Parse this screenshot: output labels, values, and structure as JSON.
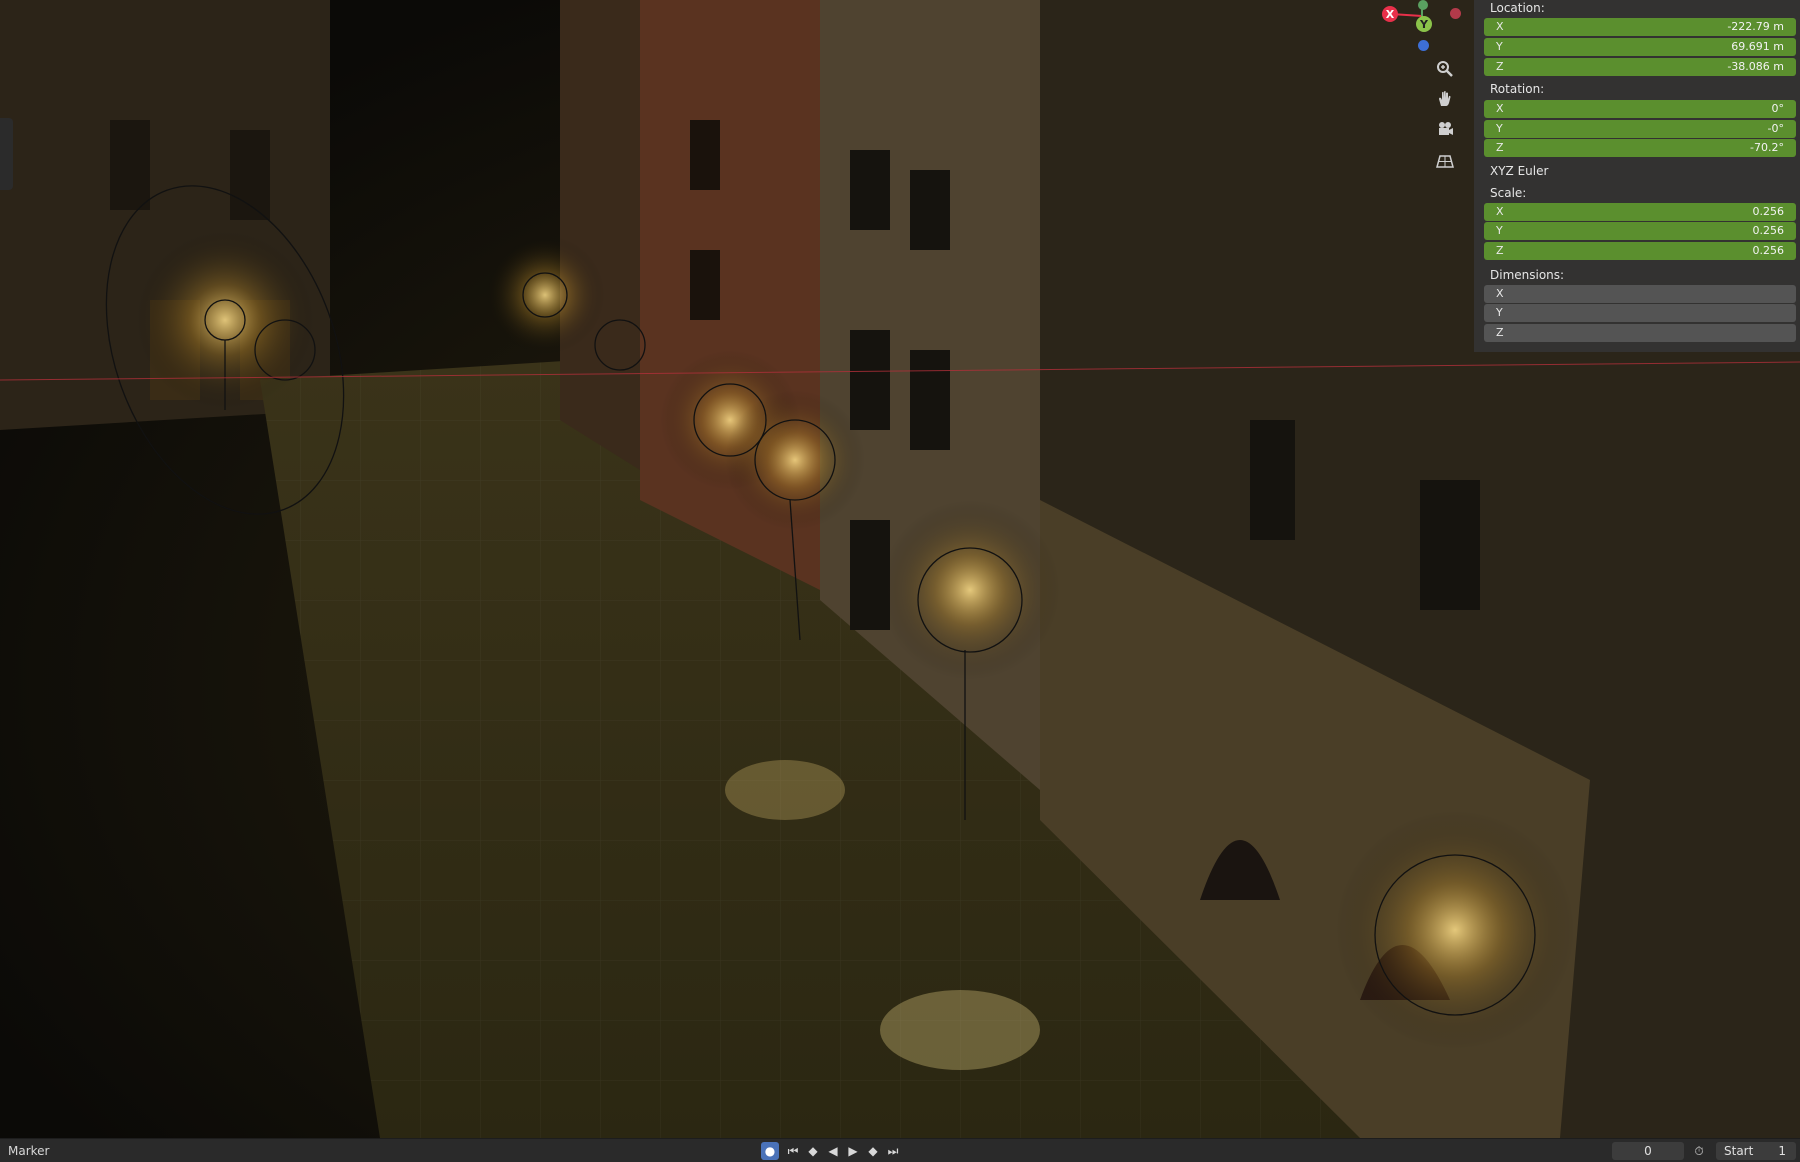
{
  "panel": {
    "location": {
      "label": "Location:",
      "x": "-222.79 m",
      "y": "69.691 m",
      "z": "-38.086 m"
    },
    "rotation": {
      "label": "Rotation:",
      "x": "0°",
      "y": "-0°",
      "z": "-70.2°"
    },
    "rotation_mode": "XYZ Euler",
    "scale": {
      "label": "Scale:",
      "x": "0.256",
      "y": "0.256",
      "z": "0.256"
    },
    "dimensions": {
      "label": "Dimensions:",
      "x": "",
      "y": "",
      "z": ""
    },
    "axis_labels": {
      "x": "X",
      "y": "Y",
      "z": "Z"
    }
  },
  "gizmo": {
    "x_label": "X",
    "y_label": "Y"
  },
  "nav_icons": [
    "zoom-icon",
    "pan-hand-icon",
    "camera-icon",
    "grid-view-icon"
  ],
  "timeline": {
    "marker_label": "Marker",
    "current_frame": "0",
    "start_label": "Start",
    "start_value": "1"
  },
  "colors": {
    "field_green": "#5b8f2e",
    "field_gray": "#545454",
    "axis_x": "#e8304a",
    "axis_y": "#8bc34a",
    "axis_z": "#3d6fd6",
    "record": "#4a72b8"
  }
}
